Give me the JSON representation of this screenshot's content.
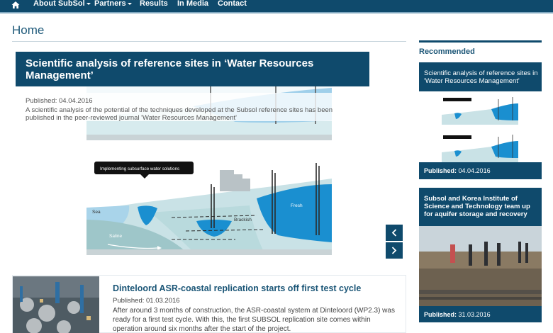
{
  "nav": {
    "items": [
      {
        "label": "About SubSol",
        "dropdown": true
      },
      {
        "label": "Partners",
        "dropdown": true
      },
      {
        "label": "Results",
        "dropdown": false
      },
      {
        "label": "In Media",
        "dropdown": false
      },
      {
        "label": "Contact",
        "dropdown": false
      }
    ],
    "icons": {
      "home": "home-icon",
      "caret": "caret-down-icon"
    }
  },
  "page": {
    "title": "Home"
  },
  "slider": {
    "title": "Scientific analysis of reference sites in ‘Water Resources Management’",
    "published": "Published: 04.04.2016",
    "description": "A scientific analysis of the potential of the techniques developed at the Subsol reference sites has been published in the peer-reviewed journal  'Water Resources Management'",
    "figure": {
      "banner": "Implementing subsurface water solutions",
      "labels": {
        "sea": "Sea",
        "saline": "Saline",
        "brackish": "Brackish",
        "fresh": "Fresh"
      }
    },
    "icons": {
      "prev": "chevron-left-icon",
      "next": "chevron-right-icon"
    }
  },
  "article": {
    "title": "Dinteloord ASR-coastal replication starts off first test cycle",
    "date": "Published: 01.03.2016",
    "text": "After around 3 months of construction, the ASR-coastal system at Dinteloord (WP2.3) was ready for a first test cycle. With this, the first SUBSOL replication site comes within operation around six months after the start of the project."
  },
  "sidebar": {
    "heading": "Recommended",
    "cards": [
      {
        "title": "Scientific analysis of reference sites in 'Water Resources Management'",
        "date_label": "Published:",
        "date": "04.04.2016"
      },
      {
        "title": "Subsol and Korea Institute of Science and Technology team up for aquifer storage and recovery",
        "date_label": "Published:",
        "date": "31.03.2016"
      }
    ]
  },
  "colors": {
    "brand": "#0f4a6c",
    "water": "#1a8fd0",
    "ground": "#c9e2e6"
  }
}
